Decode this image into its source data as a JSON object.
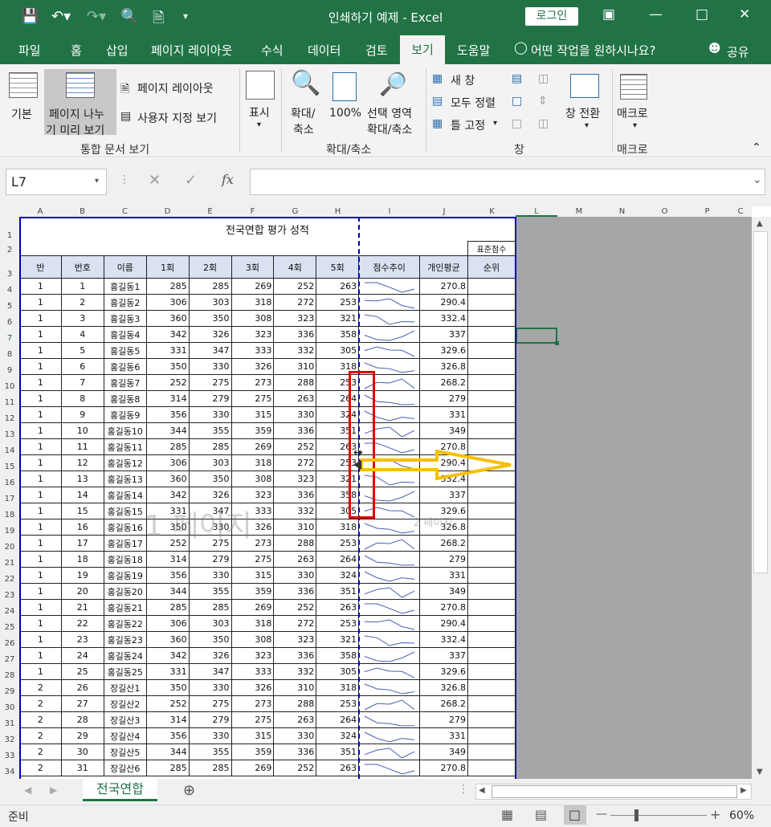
{
  "window": {
    "title": "인쇄하기 예제  -  Excel",
    "login": "로그인"
  },
  "tabs": [
    "파일",
    "홈",
    "삽입",
    "페이지 레이아웃",
    "수식",
    "데이터",
    "검토",
    "보기",
    "도움말"
  ],
  "tell_me": "어떤 작업을 원하시나요?",
  "share": "공유",
  "ribbon": {
    "normal": "기본",
    "page_break_1": "페이지 나누",
    "page_break_2": "기 미리 보기",
    "page_layout": "페이지 레이아웃",
    "custom_views": "사용자 지정 보기",
    "group_views": "통합 문서 보기",
    "show": "표시",
    "zoom_1": "확대/",
    "zoom_2": "축소",
    "zoom100": "100%",
    "zoom_sel_1": "선택 영역",
    "zoom_sel_2": "확대/축소",
    "group_zoom": "확대/축소",
    "new_window": "새 창",
    "arrange_all": "모두 정렬",
    "freeze": "틀 고정",
    "switch_windows": "창 전환",
    "group_window": "창",
    "macros": "매크로",
    "group_macros": "매크로"
  },
  "namebox": "L7",
  "col_letters": [
    "A",
    "B",
    "C",
    "D",
    "E",
    "F",
    "G",
    "H",
    "I",
    "J",
    "K",
    "L",
    "M",
    "N",
    "O",
    "P",
    "C"
  ],
  "title": "전국연합 평가 성적",
  "subheader": "표준점수",
  "headers": [
    "반",
    "번호",
    "이름",
    "1회",
    "2회",
    "3회",
    "4회",
    "5회",
    "점수추이",
    "개인평균",
    "순위"
  ],
  "rows": [
    [
      "1",
      "1",
      "홍길동1",
      "285",
      "285",
      "269",
      "252",
      "263",
      "270.8"
    ],
    [
      "1",
      "2",
      "홍길동2",
      "306",
      "303",
      "318",
      "272",
      "253",
      "290.4"
    ],
    [
      "1",
      "3",
      "홍길동3",
      "360",
      "350",
      "308",
      "323",
      "321",
      "332.4"
    ],
    [
      "1",
      "4",
      "홍길동4",
      "342",
      "326",
      "323",
      "336",
      "358",
      "337"
    ],
    [
      "1",
      "5",
      "홍길동5",
      "331",
      "347",
      "333",
      "332",
      "305",
      "329.6"
    ],
    [
      "1",
      "6",
      "홍길동6",
      "350",
      "330",
      "326",
      "310",
      "318",
      "326.8"
    ],
    [
      "1",
      "7",
      "홍길동7",
      "252",
      "275",
      "273",
      "288",
      "253",
      "268.2"
    ],
    [
      "1",
      "8",
      "홍길동8",
      "314",
      "279",
      "275",
      "263",
      "264",
      "279"
    ],
    [
      "1",
      "9",
      "홍길동9",
      "356",
      "330",
      "315",
      "330",
      "324",
      "331"
    ],
    [
      "1",
      "10",
      "홍길동10",
      "344",
      "355",
      "359",
      "336",
      "351",
      "349"
    ],
    [
      "1",
      "11",
      "홍길동11",
      "285",
      "285",
      "269",
      "252",
      "263",
      "270.8"
    ],
    [
      "1",
      "12",
      "홍길동12",
      "306",
      "303",
      "318",
      "272",
      "253",
      "290.4"
    ],
    [
      "1",
      "13",
      "홍길동13",
      "360",
      "350",
      "308",
      "323",
      "321",
      "332.4"
    ],
    [
      "1",
      "14",
      "홍길동14",
      "342",
      "326",
      "323",
      "336",
      "358",
      "337"
    ],
    [
      "1",
      "15",
      "홍길동15",
      "331",
      "347",
      "333",
      "332",
      "305",
      "329.6"
    ],
    [
      "1",
      "16",
      "홍길동16",
      "350",
      "330",
      "326",
      "310",
      "318",
      "326.8"
    ],
    [
      "1",
      "17",
      "홍길동17",
      "252",
      "275",
      "273",
      "288",
      "253",
      "268.2"
    ],
    [
      "1",
      "18",
      "홍길동18",
      "314",
      "279",
      "275",
      "263",
      "264",
      "279"
    ],
    [
      "1",
      "19",
      "홍길동19",
      "356",
      "330",
      "315",
      "330",
      "324",
      "331"
    ],
    [
      "1",
      "20",
      "홍길동20",
      "344",
      "355",
      "359",
      "336",
      "351",
      "349"
    ],
    [
      "1",
      "21",
      "홍길동21",
      "285",
      "285",
      "269",
      "252",
      "263",
      "270.8"
    ],
    [
      "1",
      "22",
      "홍길동22",
      "306",
      "303",
      "318",
      "272",
      "253",
      "290.4"
    ],
    [
      "1",
      "23",
      "홍길동23",
      "360",
      "350",
      "308",
      "323",
      "321",
      "332.4"
    ],
    [
      "1",
      "24",
      "홍길동24",
      "342",
      "326",
      "323",
      "336",
      "358",
      "337"
    ],
    [
      "1",
      "25",
      "홍길동25",
      "331",
      "347",
      "333",
      "332",
      "305",
      "329.6"
    ],
    [
      "2",
      "26",
      "장길산1",
      "350",
      "330",
      "326",
      "310",
      "318",
      "326.8"
    ],
    [
      "2",
      "27",
      "장길산2",
      "252",
      "275",
      "273",
      "288",
      "253",
      "268.2"
    ],
    [
      "2",
      "28",
      "장길산3",
      "314",
      "279",
      "275",
      "263",
      "264",
      "279"
    ],
    [
      "2",
      "29",
      "장길산4",
      "356",
      "330",
      "315",
      "330",
      "324",
      "331"
    ],
    [
      "2",
      "30",
      "장길산5",
      "344",
      "355",
      "359",
      "336",
      "351",
      "349"
    ],
    [
      "2",
      "31",
      "장길산6",
      "285",
      "285",
      "269",
      "252",
      "263",
      "270.8"
    ]
  ],
  "page1": "1 페이지",
  "page2": "2 페이지",
  "sheet_tab": "전국연합",
  "status": "준비",
  "zoom": "60%",
  "colors": {
    "accent": "#217346",
    "page_border": "#0000c0",
    "annotation_red": "#e00000",
    "arrow": "#f5c000"
  }
}
